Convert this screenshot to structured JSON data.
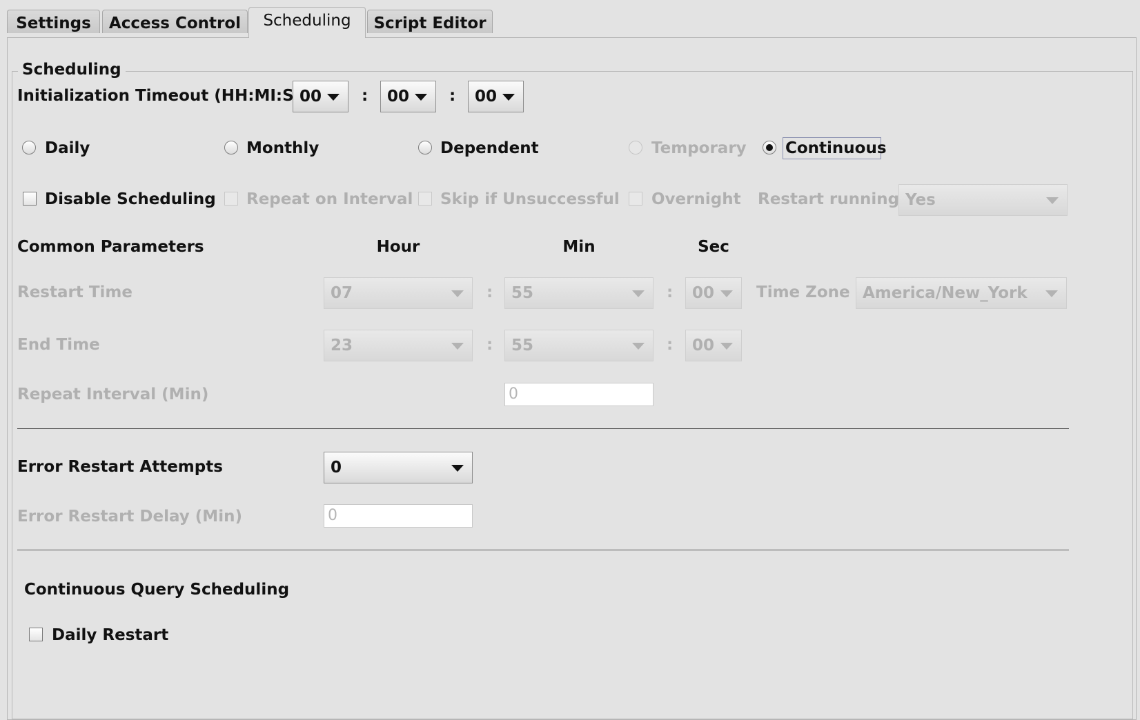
{
  "tabs": [
    {
      "label": "Settings",
      "active": false
    },
    {
      "label": "Access Control",
      "active": false
    },
    {
      "label": "Scheduling",
      "active": true
    },
    {
      "label": "Script Editor",
      "active": false
    }
  ],
  "scheduling": {
    "group_title": "Scheduling",
    "init_timeout": {
      "label": "Initialization Timeout (HH:MI:SS)",
      "hh": "00",
      "mi": "00",
      "ss": "00",
      "separator": ":"
    },
    "schedule_types": [
      {
        "label": "Daily",
        "selected": false,
        "enabled": true
      },
      {
        "label": "Monthly",
        "selected": false,
        "enabled": true
      },
      {
        "label": "Dependent",
        "selected": false,
        "enabled": true
      },
      {
        "label": "Temporary",
        "selected": false,
        "enabled": false
      },
      {
        "label": "Continuous",
        "selected": true,
        "enabled": true
      }
    ],
    "options": {
      "disable_scheduling": "Disable Scheduling",
      "repeat_on_interval": "Repeat on Interval",
      "skip_if_unsuccessful": "Skip if Unsuccessful",
      "overnight": "Overnight",
      "restart_running_label": "Restart running",
      "restart_running_value": "Yes"
    },
    "common": {
      "title": "Common Parameters",
      "col_hour": "Hour",
      "col_min": "Min",
      "col_sec": "Sec",
      "restart_time": {
        "label": "Restart Time",
        "hour": "07",
        "min": "55",
        "sec": "00"
      },
      "time_zone": {
        "label": "Time Zone",
        "value": "America/New_York"
      },
      "end_time": {
        "label": "End Time",
        "hour": "23",
        "min": "55",
        "sec": "00"
      },
      "repeat_interval": {
        "label": "Repeat Interval (Min)",
        "value": "0"
      }
    },
    "error": {
      "attempts_label": "Error Restart Attempts",
      "attempts_value": "0",
      "delay_label": "Error Restart Delay (Min)",
      "delay_value": "0"
    },
    "continuous": {
      "title": "Continuous Query Scheduling",
      "daily_restart": "Daily Restart"
    }
  }
}
